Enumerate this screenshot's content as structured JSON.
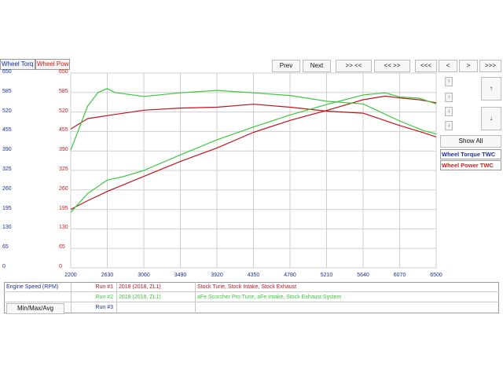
{
  "header": {
    "wheel_torque_tab": "Wheel Torq",
    "wheel_power_tab": "Wheel Pow"
  },
  "nav": {
    "prev": "Prev",
    "next": "Next",
    "b1": ">> <<",
    "b2": "<< >>",
    "b3": "<<<",
    "b4": "<",
    "b5": ">",
    "b6": ">>>"
  },
  "side": {
    "show_all": "Show All",
    "legend_torque": "Wheel Torque TWC",
    "legend_power": "Wheel Power TWC",
    "up_icon": "↑",
    "down_icon": "↓"
  },
  "footer": {
    "x_label": "Engine Speed (RPM)",
    "minmax": "Min/Max/Avg",
    "runs": [
      {
        "name": "Run #1",
        "vehicle": "2018 (2018, ZL1)",
        "desc": "Stock Tune, Stock Intake, Stock Exhaust"
      },
      {
        "name": "Run #2",
        "vehicle": "2018 (2018, ZL1)",
        "desc": "aFe Scorcher Pro Tune, aFe Intake, Stock Exhaust System"
      },
      {
        "name": "Run #3",
        "vehicle": "",
        "desc": ""
      }
    ]
  },
  "colors": {
    "run1": "#c0141c",
    "run2": "#3cc83c",
    "torque_axis": "#1a2fa0",
    "power_axis": "#c62020",
    "grid": "#cfcfcf"
  },
  "chart_data": {
    "type": "line",
    "x_ticks": [
      "2200",
      "2630",
      "3060",
      "3490",
      "3920",
      "4350",
      "4780",
      "5210",
      "5640",
      "6070",
      "6500"
    ],
    "y_left_ticks": [
      "650",
      "585",
      "520",
      "455",
      "390",
      "325",
      "260",
      "195",
      "130",
      "65",
      "0"
    ],
    "y_right_ticks": [
      "650",
      "585",
      "520",
      "455",
      "390",
      "325",
      "260",
      "195",
      "130",
      "65",
      "0"
    ],
    "xlim": [
      2200,
      6500
    ],
    "ylim": [
      0,
      650
    ],
    "grid": true,
    "series": [
      {
        "name": "Run #1",
        "metric": "torque",
        "color": "run1",
        "x": [
          2200,
          2400,
          2630,
          3060,
          3490,
          3920,
          4350,
          4780,
          5210,
          5640,
          6070,
          6350,
          6500
        ],
        "y": [
          463,
          498,
          508,
          526,
          533,
          536,
          546,
          536,
          523,
          516,
          475,
          451,
          437
        ]
      },
      {
        "name": "Run #1",
        "metric": "power",
        "color": "run1",
        "x": [
          2200,
          2400,
          2630,
          3060,
          3490,
          3920,
          4350,
          4780,
          5210,
          5640,
          5900,
          6070,
          6300,
          6500
        ],
        "y": [
          195,
          224,
          255,
          305,
          355,
          400,
          452,
          492,
          525,
          561,
          573,
          567,
          561,
          551
        ]
      },
      {
        "name": "Run #2",
        "metric": "torque",
        "color": "run2",
        "x": [
          2200,
          2400,
          2520,
          2630,
          2720,
          3060,
          3490,
          3920,
          4350,
          4780,
          5210,
          5640,
          6070,
          6350,
          6500
        ],
        "y": [
          393,
          540,
          585,
          598,
          585,
          572,
          584,
          592,
          584,
          575,
          556,
          547,
          490,
          458,
          447
        ]
      },
      {
        "name": "Run #2",
        "metric": "power",
        "color": "run2",
        "x": [
          2200,
          2400,
          2630,
          2800,
          3060,
          3490,
          3920,
          4350,
          4780,
          5210,
          5640,
          5900,
          6070,
          6300,
          6500
        ],
        "y": [
          185,
          248,
          293,
          303,
          325,
          377,
          427,
          470,
          510,
          545,
          577,
          584,
          570,
          566,
          547
        ]
      }
    ]
  }
}
